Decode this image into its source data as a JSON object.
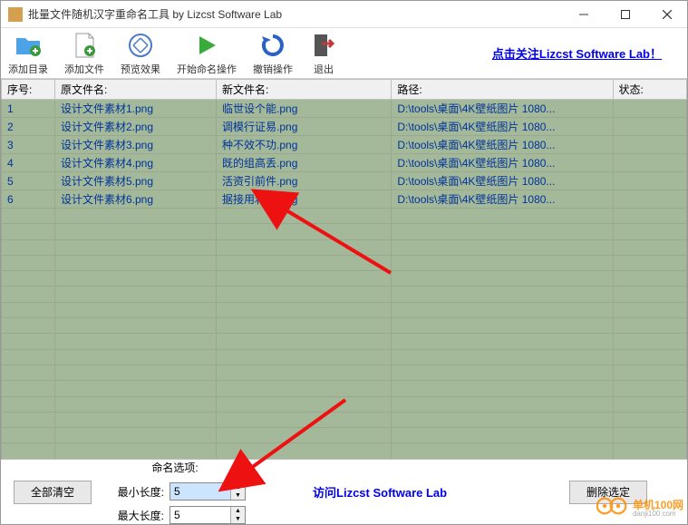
{
  "window": {
    "title": "批量文件随机汉字重命名工具    by Lizcst Software Lab"
  },
  "toolbar": {
    "add_dir": "添加目录",
    "add_file": "添加文件",
    "preview": "预览效果",
    "start": "开始命名操作",
    "undo": "撤销操作",
    "exit": "退出",
    "link": "点击关注Lizcst Software Lab！"
  },
  "columns": {
    "seq": "序号:",
    "orig": "原文件名:",
    "newname": "新文件名:",
    "path": "路径:",
    "status": "状态:"
  },
  "rows": [
    {
      "seq": "1",
      "orig": "设计文件素材1.png",
      "newname": "临世设个能.png",
      "path": "D:\\tools\\桌面\\4K壁纸图片 1080...",
      "status": ""
    },
    {
      "seq": "2",
      "orig": "设计文件素材2.png",
      "newname": "调模行证易.png",
      "path": "D:\\tools\\桌面\\4K壁纸图片 1080...",
      "status": ""
    },
    {
      "seq": "3",
      "orig": "设计文件素材3.png",
      "newname": "种不效不功.png",
      "path": "D:\\tools\\桌面\\4K壁纸图片 1080...",
      "status": ""
    },
    {
      "seq": "4",
      "orig": "设计文件素材4.png",
      "newname": "既的组高丢.png",
      "path": "D:\\tools\\桌面\\4K壁纸图片 1080...",
      "status": ""
    },
    {
      "seq": "5",
      "orig": "设计文件素材5.png",
      "newname": "活资引前件.png",
      "path": "D:\\tools\\桌面\\4K壁纸图片 1080...",
      "status": ""
    },
    {
      "seq": "6",
      "orig": "设计文件素材6.png",
      "newname": "据接用利多.png",
      "path": "D:\\tools\\桌面\\4K壁纸图片 1080...",
      "status": ""
    }
  ],
  "empty_rows": 17,
  "bottom": {
    "clear_all": "全部清空",
    "opts_header": "命名选项:",
    "min_label": "最小长度:",
    "min_value": "5",
    "max_label": "最大长度:",
    "max_value": "5",
    "visit": "访问Lizcst Software Lab",
    "delete_sel": "删除选定"
  },
  "watermark": {
    "cn": "单机100网",
    "en": "danji100.com"
  }
}
